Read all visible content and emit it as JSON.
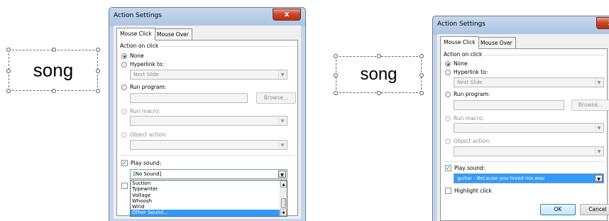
{
  "left": {
    "shape_text": "song",
    "dialog": {
      "title": "Action Settings",
      "close_glyph": "x",
      "tabs": [
        "Mouse Click",
        "Mouse Over"
      ],
      "group_label": "Action on click",
      "options": {
        "none": "None",
        "hyperlink": "Hyperlink to:",
        "run_program": "Run program:",
        "run_macro": "Run macro:",
        "object_action": "Object action:"
      },
      "hyperlink_value": "Next Slide",
      "browse_label": "Browse...",
      "play_sound_label": "Play sound:",
      "sound_value": "[No Sound]",
      "sound_list": [
        "Suction",
        "Typewriter",
        "Voltage",
        "Whoosh",
        "Wind",
        "Other Sound..."
      ],
      "sound_list_selected_index": 5
    }
  },
  "right": {
    "shape_text": "song",
    "dialog": {
      "title": "Action Settings",
      "close_glyph": "x",
      "tabs": [
        "Mouse Click",
        "Mouse Over"
      ],
      "group_label": "Action on click",
      "options": {
        "none": "None",
        "hyperlink": "Hyperlink to:",
        "run_program": "Run program:",
        "run_macro": "Run macro:",
        "object_action": "Object action:"
      },
      "hyperlink_value": "Next Slide",
      "browse_label": "Browse...",
      "play_sound_label": "Play sound:",
      "sound_value": "guitar - Because you loved me.wav",
      "highlight_click_label": "Highlight click",
      "ok_label": "OK",
      "cancel_label": "Cancel"
    }
  },
  "icons": {
    "close": "close-icon",
    "dropdown": "chevron-down-icon",
    "check": "checkmark-icon"
  }
}
